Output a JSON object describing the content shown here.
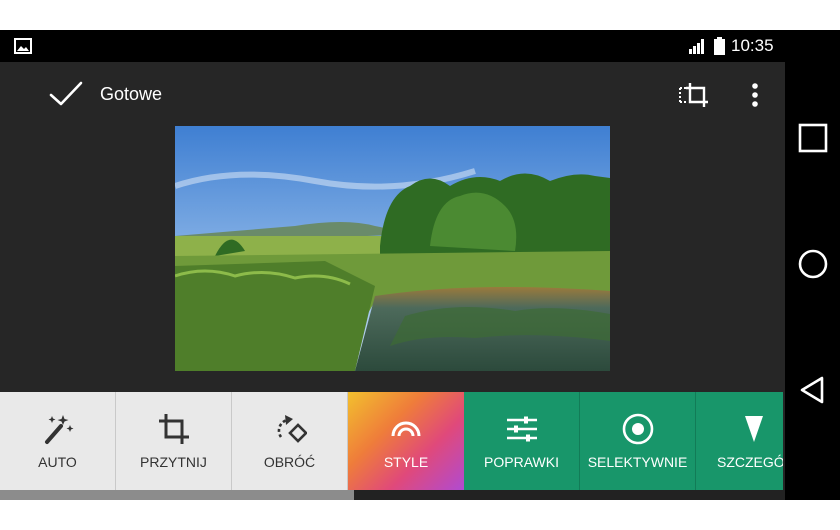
{
  "status_bar": {
    "time": "10:35",
    "icons": [
      "gallery-icon",
      "signal-icon",
      "battery-icon"
    ]
  },
  "toolbar": {
    "done_label": "Gotowe",
    "icons": [
      "check-icon",
      "compare-crop-icon",
      "more-vert-icon"
    ]
  },
  "tools": [
    {
      "label": "AUTO",
      "icon": "magic-wand-icon"
    },
    {
      "label": "PRZYTNIJ",
      "icon": "crop-icon"
    },
    {
      "label": "OBRÓĆ",
      "icon": "rotate-icon"
    },
    {
      "label": "STYLE",
      "icon": "arc-icon"
    },
    {
      "label": "POPRAWKI",
      "icon": "sliders-icon"
    },
    {
      "label": "SELEKTYWNIE",
      "icon": "target-icon"
    },
    {
      "label": "SZCZEGÓŁ",
      "icon": "triangle-down-icon"
    }
  ],
  "scroll": {
    "position": 0.42
  },
  "nav": [
    "recents-icon",
    "home-icon",
    "back-icon"
  ],
  "colors": {
    "app_background": "#262626",
    "tool_light": "#e9e9e9",
    "tool_green": "#18966a",
    "accent_white": "#ffffff"
  }
}
